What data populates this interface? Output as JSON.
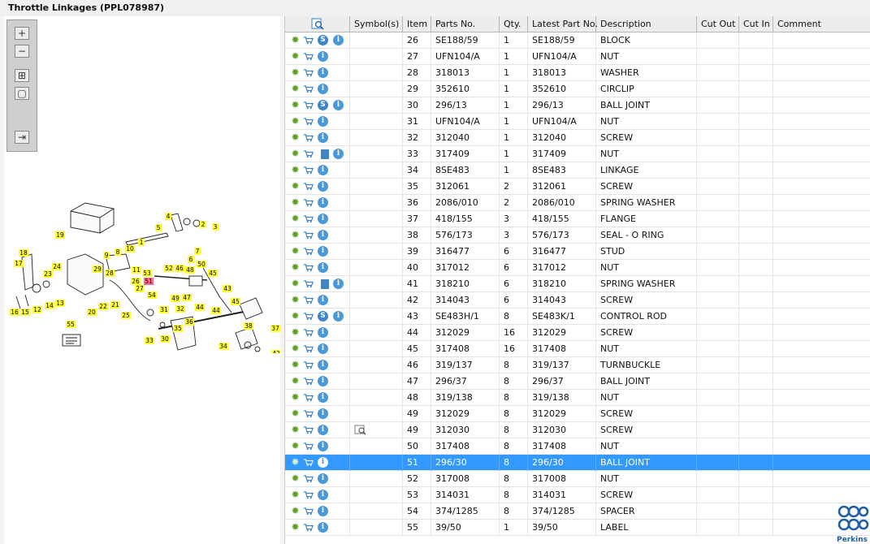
{
  "title": "Throttle Linkages (PPL078987)",
  "toolbar": {
    "zoom_in": "+",
    "zoom_out": "−",
    "fit": "⊞",
    "actual": "▢",
    "export": "⇥"
  },
  "columns": {
    "symbols": "Symbol(s)",
    "item": "Item",
    "parts_no": "Parts No.",
    "qty": "Qty.",
    "latest": "Latest Part No.",
    "description": "Description",
    "cut_out": "Cut Out",
    "cut_in": "Cut In",
    "comment": "Comment"
  },
  "rows": [
    {
      "item": "26",
      "parts": "SE188/59",
      "qty": "1",
      "latest": "SE188/59",
      "desc": "BLOCK",
      "badge": "S"
    },
    {
      "item": "27",
      "parts": "UFN104/A",
      "qty": "1",
      "latest": "UFN104/A",
      "desc": "NUT",
      "badge": ""
    },
    {
      "item": "28",
      "parts": "318013",
      "qty": "1",
      "latest": "318013",
      "desc": "WASHER",
      "badge": ""
    },
    {
      "item": "29",
      "parts": "352610",
      "qty": "1",
      "latest": "352610",
      "desc": "CIRCLIP",
      "badge": ""
    },
    {
      "item": "30",
      "parts": "296/13",
      "qty": "1",
      "latest": "296/13",
      "desc": "BALL JOINT",
      "badge": "S"
    },
    {
      "item": "31",
      "parts": "UFN104/A",
      "qty": "1",
      "latest": "UFN104/A",
      "desc": "NUT",
      "badge": ""
    },
    {
      "item": "32",
      "parts": "312040",
      "qty": "1",
      "latest": "312040",
      "desc": "SCREW",
      "badge": ""
    },
    {
      "item": "33",
      "parts": "317409",
      "qty": "1",
      "latest": "317409",
      "desc": "NUT",
      "badge": "book"
    },
    {
      "item": "34",
      "parts": "8SE483",
      "qty": "1",
      "latest": "8SE483",
      "desc": "LINKAGE",
      "badge": ""
    },
    {
      "item": "35",
      "parts": "312061",
      "qty": "2",
      "latest": "312061",
      "desc": "SCREW",
      "badge": ""
    },
    {
      "item": "36",
      "parts": "2086/010",
      "qty": "2",
      "latest": "2086/010",
      "desc": "SPRING WASHER",
      "badge": ""
    },
    {
      "item": "37",
      "parts": "418/155",
      "qty": "3",
      "latest": "418/155",
      "desc": "FLANGE",
      "badge": ""
    },
    {
      "item": "38",
      "parts": "576/173",
      "qty": "3",
      "latest": "576/173",
      "desc": "SEAL - O RING",
      "badge": ""
    },
    {
      "item": "39",
      "parts": "316477",
      "qty": "6",
      "latest": "316477",
      "desc": "STUD",
      "badge": ""
    },
    {
      "item": "40",
      "parts": "317012",
      "qty": "6",
      "latest": "317012",
      "desc": "NUT",
      "badge": ""
    },
    {
      "item": "41",
      "parts": "318210",
      "qty": "6",
      "latest": "318210",
      "desc": "SPRING WASHER",
      "badge": "book"
    },
    {
      "item": "42",
      "parts": "314043",
      "qty": "6",
      "latest": "314043",
      "desc": "SCREW",
      "badge": ""
    },
    {
      "item": "43",
      "parts": "SE483H/1",
      "qty": "8",
      "latest": "SE483K/1",
      "desc": "CONTROL ROD",
      "badge": "S"
    },
    {
      "item": "44",
      "parts": "312029",
      "qty": "16",
      "latest": "312029",
      "desc": "SCREW",
      "badge": ""
    },
    {
      "item": "45",
      "parts": "317408",
      "qty": "16",
      "latest": "317408",
      "desc": "NUT",
      "badge": ""
    },
    {
      "item": "46",
      "parts": "319/137",
      "qty": "8",
      "latest": "319/137",
      "desc": "TURNBUCKLE",
      "badge": ""
    },
    {
      "item": "47",
      "parts": "296/37",
      "qty": "8",
      "latest": "296/37",
      "desc": "BALL JOINT",
      "badge": ""
    },
    {
      "item": "48",
      "parts": "319/138",
      "qty": "8",
      "latest": "319/138",
      "desc": "NUT",
      "badge": ""
    },
    {
      "item": "49",
      "parts": "312029",
      "qty": "8",
      "latest": "312029",
      "desc": "SCREW",
      "badge": ""
    },
    {
      "item": "49",
      "parts": "312030",
      "qty": "8",
      "latest": "312030",
      "desc": "SCREW",
      "badge": "",
      "symbol": "see"
    },
    {
      "item": "50",
      "parts": "317408",
      "qty": "8",
      "latest": "317408",
      "desc": "NUT",
      "badge": ""
    },
    {
      "item": "51",
      "parts": "296/30",
      "qty": "8",
      "latest": "296/30",
      "desc": "BALL JOINT",
      "badge": "",
      "selected": true
    },
    {
      "item": "52",
      "parts": "317008",
      "qty": "8",
      "latest": "317008",
      "desc": "NUT",
      "badge": ""
    },
    {
      "item": "53",
      "parts": "314031",
      "qty": "8",
      "latest": "314031",
      "desc": "SCREW",
      "badge": ""
    },
    {
      "item": "54",
      "parts": "374/1285",
      "qty": "8",
      "latest": "374/1285",
      "desc": "SPACER",
      "badge": ""
    },
    {
      "item": "55",
      "parts": "39/50",
      "qty": "1",
      "latest": "39/50",
      "desc": "LABEL",
      "badge": ""
    }
  ],
  "callouts": [
    {
      "n": "1"
    },
    {
      "n": "2"
    },
    {
      "n": "3"
    },
    {
      "n": "4"
    },
    {
      "n": "5"
    },
    {
      "n": "6"
    },
    {
      "n": "7"
    },
    {
      "n": "8"
    },
    {
      "n": "9"
    },
    {
      "n": "10"
    },
    {
      "n": "11"
    },
    {
      "n": "12"
    },
    {
      "n": "13"
    },
    {
      "n": "14"
    },
    {
      "n": "15"
    },
    {
      "n": "16"
    },
    {
      "n": "17"
    },
    {
      "n": "18"
    },
    {
      "n": "19"
    },
    {
      "n": "20"
    },
    {
      "n": "21"
    },
    {
      "n": "22"
    },
    {
      "n": "23"
    },
    {
      "n": "24"
    },
    {
      "n": "25"
    },
    {
      "n": "26"
    },
    {
      "n": "27"
    },
    {
      "n": "28"
    },
    {
      "n": "29"
    },
    {
      "n": "30"
    },
    {
      "n": "31"
    },
    {
      "n": "32"
    },
    {
      "n": "33"
    },
    {
      "n": "34"
    },
    {
      "n": "35"
    },
    {
      "n": "36"
    },
    {
      "n": "37"
    },
    {
      "n": "38"
    },
    {
      "n": "39"
    },
    {
      "n": "40"
    },
    {
      "n": "41"
    },
    {
      "n": "42"
    },
    {
      "n": "43"
    },
    {
      "n": "44"
    },
    {
      "n": "44"
    },
    {
      "n": "45"
    },
    {
      "n": "45"
    },
    {
      "n": "46"
    },
    {
      "n": "47"
    },
    {
      "n": "48"
    },
    {
      "n": "49"
    },
    {
      "n": "50"
    },
    {
      "n": "51",
      "highlight": true
    },
    {
      "n": "52"
    },
    {
      "n": "53"
    },
    {
      "n": "54"
    },
    {
      "n": "55"
    }
  ],
  "logo": {
    "text": "Perkins",
    "color": "#1f5fa8"
  },
  "colors": {
    "selection": "#3399ff",
    "callout": "#ffff33",
    "callout_selected": "#ff6b8a"
  }
}
